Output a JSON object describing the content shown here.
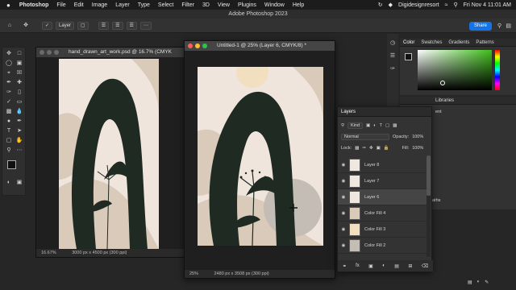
{
  "menubar": {
    "apple": "",
    "items": [
      "Photoshop",
      "File",
      "Edit",
      "Image",
      "Layer",
      "Type",
      "Select",
      "Filter",
      "3D",
      "View",
      "Plugins",
      "Window",
      "Help"
    ],
    "user": "Digidesignresort",
    "datetime": "Fri Nov 4  11:01 AM"
  },
  "window_title": "Adobe Photoshop 2023",
  "optionsbar": {
    "select_target": "Layer",
    "share_label": "Share"
  },
  "doc1": {
    "title": "hand_drawn_art_work.psd @ 16.7% (CMYK",
    "zoom": "16.67%",
    "size": "3000 px x 4500 px (300 ppi)"
  },
  "doc2": {
    "title": "Untitled-1 @ 25% (Layer 6, CMYK/8) *",
    "zoom": "25%",
    "size": "2480 px x 3508 px (300 ppi)"
  },
  "color_panel": {
    "tabs": [
      "Color",
      "Swatches",
      "Gradients",
      "Patterns"
    ]
  },
  "libraries_panel": {
    "tabs": [
      "Libraries"
    ],
    "fragment1": "ent",
    "fragment2": "aths"
  },
  "layers_panel": {
    "title": "Layers",
    "filter_label": "Kind",
    "blend_mode": "Normal",
    "opacity_label": "Opacity:",
    "opacity_value": "100%",
    "lock_label": "Lock:",
    "fill_label": "Fill:",
    "fill_value": "100%",
    "layers": [
      {
        "name": "Layer 8",
        "selected": false
      },
      {
        "name": "Layer 7",
        "selected": false
      },
      {
        "name": "Layer 6",
        "selected": true
      },
      {
        "name": "Color Fill 4",
        "selected": false
      },
      {
        "name": "Color Fill 3",
        "selected": false
      },
      {
        "name": "Color Fill 2",
        "selected": false
      }
    ],
    "footer_icons": [
      "link-icon",
      "fx-icon",
      "mask-icon",
      "adjustment-icon",
      "folder-icon",
      "new-layer-icon",
      "trash-icon"
    ]
  },
  "colors": {
    "accent": "#1473e6",
    "canvas_bg": "#efe5dc",
    "dark_shape": "#1f2a22",
    "beige_shape": "#d8c9b8",
    "sun": "#f1dfc0"
  }
}
